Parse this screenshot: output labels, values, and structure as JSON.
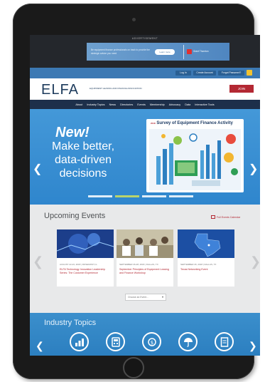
{
  "ad": {
    "label": "ADVERTISEMENT",
    "body": "Be equipment finance professionals on track to provide the strategic advice you need",
    "button": "Learn more",
    "partner": "Grant Thornton",
    "partner_sub": "An instinct for growth"
  },
  "util": {
    "login": "Log In",
    "create_account": "Create Account",
    "forgot_password": "Forgot Password?"
  },
  "header": {
    "logo": "ELFA",
    "logo_sub": "EQUIPMENT LEASING AND FINANCE ASSOCIATION",
    "join": "JOIN"
  },
  "nav": {
    "items": [
      "About",
      "Industry Topics",
      "News",
      "Directories",
      "Events",
      "Membership",
      "Advocacy",
      "Data",
      "Interactive Tools"
    ]
  },
  "hero": {
    "new_label": "New!",
    "line1": "Make better,",
    "line2": "data-driven",
    "line3": "decisions",
    "survey_title": "Survey of Equipment Finance Activity",
    "survey_year": "2018"
  },
  "events": {
    "title": "Upcoming Events",
    "calendar_link": "Full Events Calendar",
    "cards": [
      {
        "date": "AUGUST 22-23, 2018  |  ROSEMONT, IL",
        "title": "ELFA Technology Innovation Leadership Series: The Customer Experience"
      },
      {
        "date": "SEPTEMBER 26-28, 2018  |  DALLAS, TX",
        "title": "September Principles of Equipment Leasing and Finance Workshop"
      },
      {
        "date": "SEPTEMBER 26, 2018  |  DALLAS, TX",
        "title": "Texas Networking Event"
      }
    ],
    "choose_label": "Choose an Event..."
  },
  "topics": {
    "title": "Industry Topics"
  },
  "colors": {
    "accent_red": "#b32833",
    "nav_navy": "#1d2f4a",
    "hero_blue": "#3a8fd2",
    "utility_blue": "#3c79b4"
  }
}
